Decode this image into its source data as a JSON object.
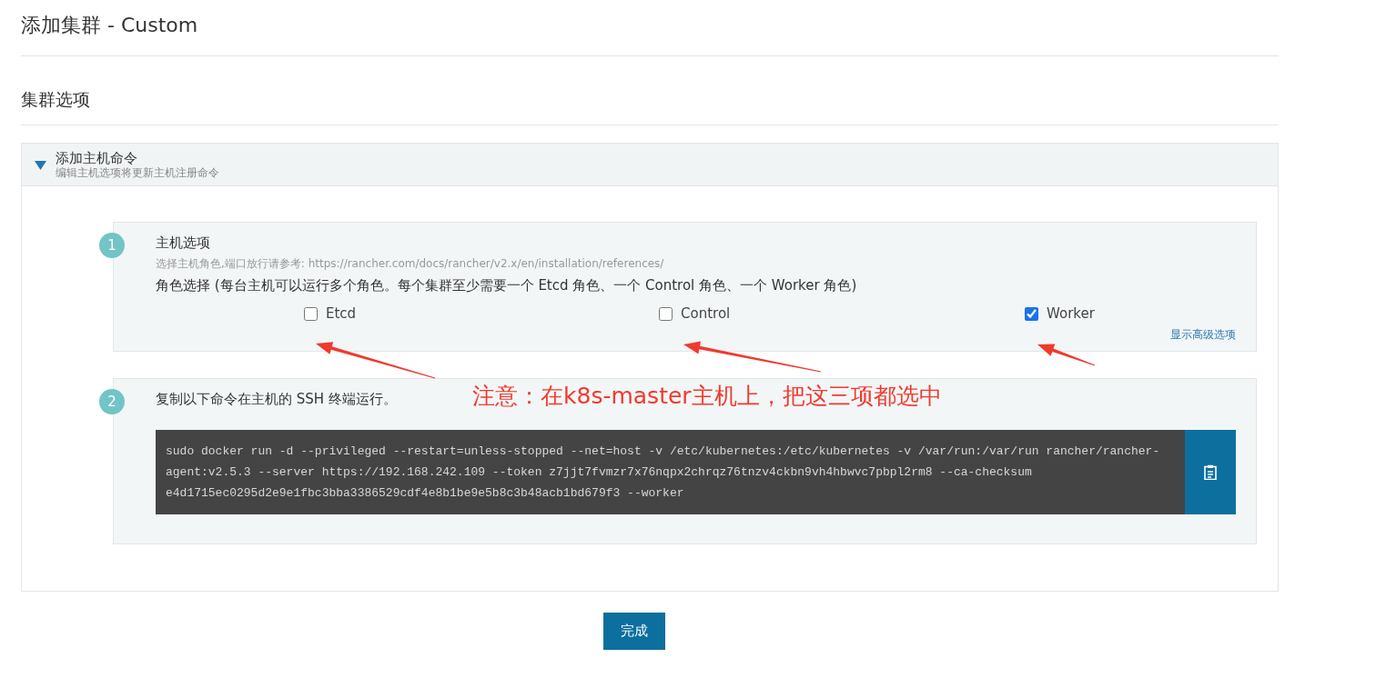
{
  "page_title": "添加集群 - Custom",
  "section_title": "集群选项",
  "accordion": {
    "title": "添加主机命令",
    "subtitle": "编辑主机选项将更新主机注册命令",
    "expanded": true
  },
  "steps": [
    {
      "number": "1",
      "title": "主机选项",
      "hint": "选择主机角色,端口放行请参考: https://rancher.com/docs/rancher/v2.x/en/installation/references/",
      "role_prompt": "角色选择 (每台主机可以运行多个角色。每个集群至少需要一个 Etcd 角色、一个 Control 角色、一个 Worker 角色)",
      "roles": [
        {
          "label": "Etcd",
          "checked": false
        },
        {
          "label": "Control",
          "checked": false
        },
        {
          "label": "Worker",
          "checked": true
        }
      ],
      "advanced_link": "显示高级选项"
    },
    {
      "number": "2",
      "title": "复制以下命令在主机的 SSH 终端运行。",
      "command": "sudo docker run -d --privileged --restart=unless-stopped --net=host -v /etc/kubernetes:/etc/kubernetes -v /var/run:/var/run rancher/rancher-agent:v2.5.3 --server https://192.168.242.109 --token z7jjt7fvmzr7x76nqpx2chrqz76tnzv4ckbn9vh4hbwvc7pbpl2rm8 --ca-checksum e4d1715ec0295d2e9e1fbc3bba3386529cdf4e8b1be9e5b8c3b48acb1bd679f3 --worker"
    }
  ],
  "annotation": {
    "text": "注意：在k8s-master主机上，把这三项都选中"
  },
  "done_button": "完成"
}
